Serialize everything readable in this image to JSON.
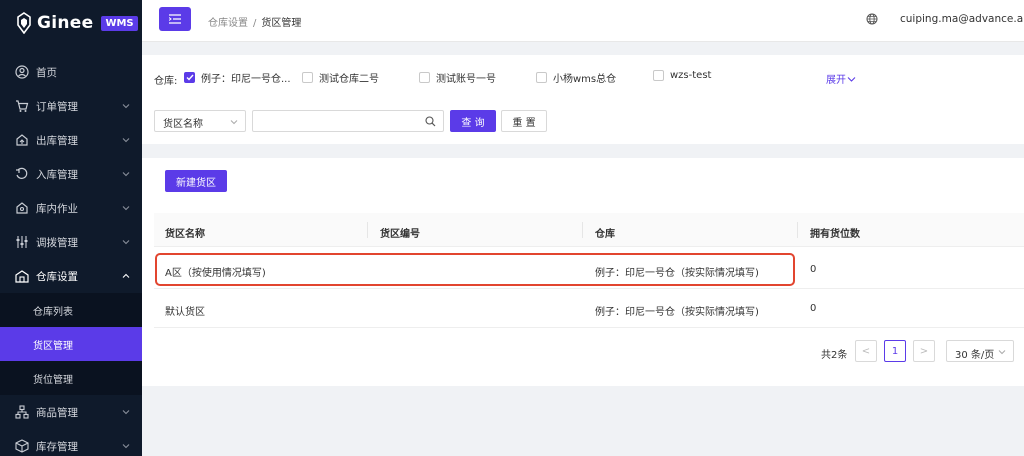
{
  "brand": {
    "name": "Ginee",
    "badge": "WMS",
    "accent": "#5b3be8"
  },
  "sidebar": {
    "items": [
      {
        "label": "首页",
        "icon": "user-circle-icon"
      },
      {
        "label": "订单管理",
        "icon": "cart-icon"
      },
      {
        "label": "出库管理",
        "icon": "outbound-icon"
      },
      {
        "label": "入库管理",
        "icon": "inbound-icon"
      },
      {
        "label": "库内作业",
        "icon": "location-icon"
      },
      {
        "label": "调拨管理",
        "icon": "sliders-icon"
      },
      {
        "label": "仓库设置",
        "icon": "warehouse-icon"
      },
      {
        "label": "商品管理",
        "icon": "hierarchy-icon"
      },
      {
        "label": "库存管理",
        "icon": "box-icon"
      }
    ],
    "submenu": [
      {
        "label": "仓库列表"
      },
      {
        "label": "货区管理"
      },
      {
        "label": "货位管理"
      }
    ]
  },
  "header": {
    "breadcrumb": [
      "仓库设置",
      "货区管理"
    ],
    "breadcrumb_sep": "/",
    "user_email": "cuiping.ma@advance.ai"
  },
  "filter": {
    "warehouse_label": "仓库:",
    "warehouses": [
      {
        "label": "例子：印尼一号仓...",
        "checked": true
      },
      {
        "label": "测试仓库二号",
        "checked": false
      },
      {
        "label": "测试账号一号",
        "checked": false
      },
      {
        "label": "小杨wms总仓",
        "checked": false
      },
      {
        "label": "wzs-test",
        "checked": false
      }
    ],
    "expand_label": "展开",
    "field_select": "货区名称",
    "search_value": "",
    "query_button": "查 询",
    "reset_button": "重 置"
  },
  "table": {
    "new_button": "新建货区",
    "columns": [
      "货区名称",
      "货区编号",
      "仓库",
      "拥有货位数"
    ],
    "rows": [
      [
        "A区（按使用情况填写)",
        "",
        "例子：印尼一号仓（按实际情况填写)",
        "0"
      ],
      [
        "默认货区",
        "",
        "例子：印尼一号仓（按实际情况填写)",
        "0"
      ]
    ]
  },
  "pagination": {
    "total": "共2条",
    "prev": "<",
    "current_page": "1",
    "next": ">",
    "page_size": "30 条/页"
  }
}
